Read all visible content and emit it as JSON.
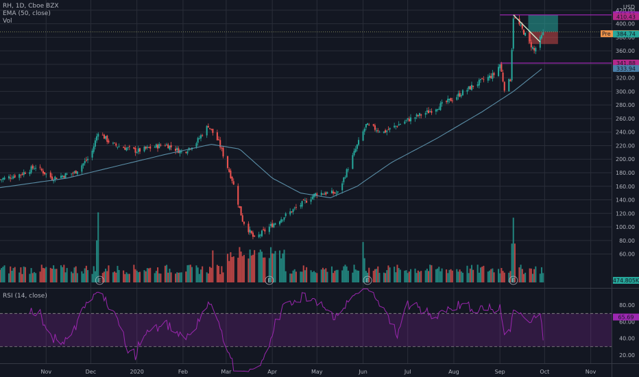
{
  "legend": {
    "symbol": "RH, 1D, Cboe BZX",
    "ema": "EMA (50, close)",
    "vol": "Vol",
    "rsi": "RSI (14, close)"
  },
  "header": {
    "currency": "USD"
  },
  "colors": {
    "background": "#131722",
    "up": "#26a69a",
    "down": "#ef5350",
    "ema": "#5b8fa8",
    "rsi": "#9c27b0",
    "grid": "#2a2e39",
    "text": "#b2b5be",
    "levels": "#9c27b0"
  },
  "chart_data": [
    {
      "type": "candlestick",
      "title": "RH, 1D, Cboe BZX",
      "ylim": [
        10,
        435
      ],
      "ytick_labels": [
        "420.00",
        "400.00",
        "380.00",
        "360.00",
        "340.00",
        "320.00",
        "300.00",
        "280.00",
        "260.00",
        "240.00",
        "220.00",
        "200.00",
        "180.00",
        "160.00",
        "140.00",
        "120.00",
        "100.00",
        "80.00",
        "60.00"
      ],
      "ytick_values": [
        420,
        400,
        380,
        360,
        340,
        320,
        300,
        280,
        260,
        240,
        220,
        200,
        180,
        160,
        140,
        120,
        100,
        80,
        60
      ],
      "xtick_labels": [
        "Nov",
        "Dec",
        "2020",
        "Feb",
        "Mar",
        "Apr",
        "May",
        "Jun",
        "Jul",
        "Aug",
        "Sep",
        "Oct",
        "Nov"
      ],
      "xtick_dates": [
        "2019-11-01",
        "2019-12-01",
        "2020-01-01",
        "2020-02-01",
        "2020-03-01",
        "2020-04-01",
        "2020-05-01",
        "2020-06-01",
        "2020-07-01",
        "2020-08-01",
        "2020-09-01",
        "2020-10-01",
        "2020-11-01"
      ],
      "x_range": [
        "2019-10-01",
        "2020-11-15"
      ],
      "price_path": [
        {
          "date": "2019-10-01",
          "close": 170
        },
        {
          "date": "2019-10-15",
          "close": 178
        },
        {
          "date": "2019-10-25",
          "close": 189
        },
        {
          "date": "2019-11-05",
          "close": 172
        },
        {
          "date": "2019-11-20",
          "close": 180
        },
        {
          "date": "2019-12-01",
          "close": 205
        },
        {
          "date": "2019-12-06",
          "close": 241
        },
        {
          "date": "2019-12-15",
          "close": 222
        },
        {
          "date": "2020-01-01",
          "close": 212
        },
        {
          "date": "2020-01-20",
          "close": 222
        },
        {
          "date": "2020-02-01",
          "close": 210
        },
        {
          "date": "2020-02-10",
          "close": 225
        },
        {
          "date": "2020-02-18",
          "close": 250
        },
        {
          "date": "2020-02-25",
          "close": 225
        },
        {
          "date": "2020-03-05",
          "close": 170
        },
        {
          "date": "2020-03-12",
          "close": 110
        },
        {
          "date": "2020-03-20",
          "close": 82
        },
        {
          "date": "2020-03-30",
          "close": 100
        },
        {
          "date": "2020-04-15",
          "close": 125
        },
        {
          "date": "2020-05-01",
          "close": 150
        },
        {
          "date": "2020-05-15",
          "close": 150
        },
        {
          "date": "2020-05-28",
          "close": 220
        },
        {
          "date": "2020-06-03",
          "close": 250
        },
        {
          "date": "2020-06-15",
          "close": 240
        },
        {
          "date": "2020-07-01",
          "close": 258
        },
        {
          "date": "2020-07-15",
          "close": 270
        },
        {
          "date": "2020-08-01",
          "close": 290
        },
        {
          "date": "2020-08-15",
          "close": 310
        },
        {
          "date": "2020-08-28",
          "close": 325
        },
        {
          "date": "2020-09-01",
          "close": 340
        },
        {
          "date": "2020-09-04",
          "close": 305
        },
        {
          "date": "2020-09-08",
          "close": 318
        },
        {
          "date": "2020-09-10",
          "close": 410
        },
        {
          "date": "2020-09-15",
          "close": 395
        },
        {
          "date": "2020-09-22",
          "close": 368
        },
        {
          "date": "2020-09-24",
          "close": 360
        },
        {
          "date": "2020-09-30",
          "close": 385
        }
      ],
      "ema_path": [
        {
          "date": "2019-10-01",
          "value": 158
        },
        {
          "date": "2019-11-15",
          "value": 172
        },
        {
          "date": "2019-12-15",
          "value": 188
        },
        {
          "date": "2020-01-20",
          "value": 207
        },
        {
          "date": "2020-02-20",
          "value": 222
        },
        {
          "date": "2020-03-10",
          "value": 215
        },
        {
          "date": "2020-04-01",
          "value": 172
        },
        {
          "date": "2020-04-20",
          "value": 150
        },
        {
          "date": "2020-05-10",
          "value": 143
        },
        {
          "date": "2020-05-28",
          "value": 160
        },
        {
          "date": "2020-06-20",
          "value": 195
        },
        {
          "date": "2020-07-20",
          "value": 230
        },
        {
          "date": "2020-08-20",
          "value": 270
        },
        {
          "date": "2020-09-10",
          "value": 300
        },
        {
          "date": "2020-09-30",
          "value": 335
        }
      ],
      "earnings_dates": [
        "2019-12-07",
        "2020-03-30",
        "2020-06-04",
        "2020-09-10"
      ],
      "earnings_label": "E",
      "price_tags": [
        {
          "label": "413.19",
          "value": 413.19,
          "color": "#9c27b0"
        },
        {
          "label": "410.43",
          "value": 410.43,
          "color": "#b3288b"
        },
        {
          "label": "388.03",
          "value": 388.03,
          "color": "#131722"
        },
        {
          "label": "385.24",
          "value": 385.24,
          "color": "#f0944a",
          "prefix": "Pre"
        },
        {
          "label": "384.74",
          "value": 384.74,
          "color": "#26a69a"
        },
        {
          "label": "370.35",
          "value": 370.35,
          "color": "#131722"
        },
        {
          "label": "341.88",
          "value": 341.88,
          "color": "#b3288b"
        },
        {
          "label": "333.94",
          "value": 333.94,
          "color": "#4a7fa8"
        }
      ],
      "horizontal_levels": [
        413,
        341.88
      ],
      "position_box": {
        "entry": 388,
        "target": 413,
        "stop": 370,
        "start": "2020-09-20",
        "end": "2020-10-10"
      },
      "trendline": {
        "start_date": "2020-09-10",
        "start_value": 413,
        "end_date": "2020-09-28",
        "end_value": 373
      }
    },
    {
      "type": "bar",
      "title": "Vol",
      "last_label": "474.805K",
      "peaks": [
        {
          "date": "2019-12-06",
          "value": 142
        },
        {
          "date": "2020-02-22",
          "value": 120
        },
        {
          "date": "2020-06-01",
          "value": 103
        },
        {
          "date": "2020-09-10",
          "value": 135
        }
      ]
    },
    {
      "type": "line",
      "title": "RSI (14, close)",
      "last_label": "65.69",
      "last_value": 65.69,
      "bands": [
        30,
        70
      ],
      "ytick_labels": [
        "80.00",
        "60.00",
        "40.00",
        "20.00"
      ],
      "ytick_values": [
        80,
        60,
        40,
        20
      ]
    }
  ]
}
